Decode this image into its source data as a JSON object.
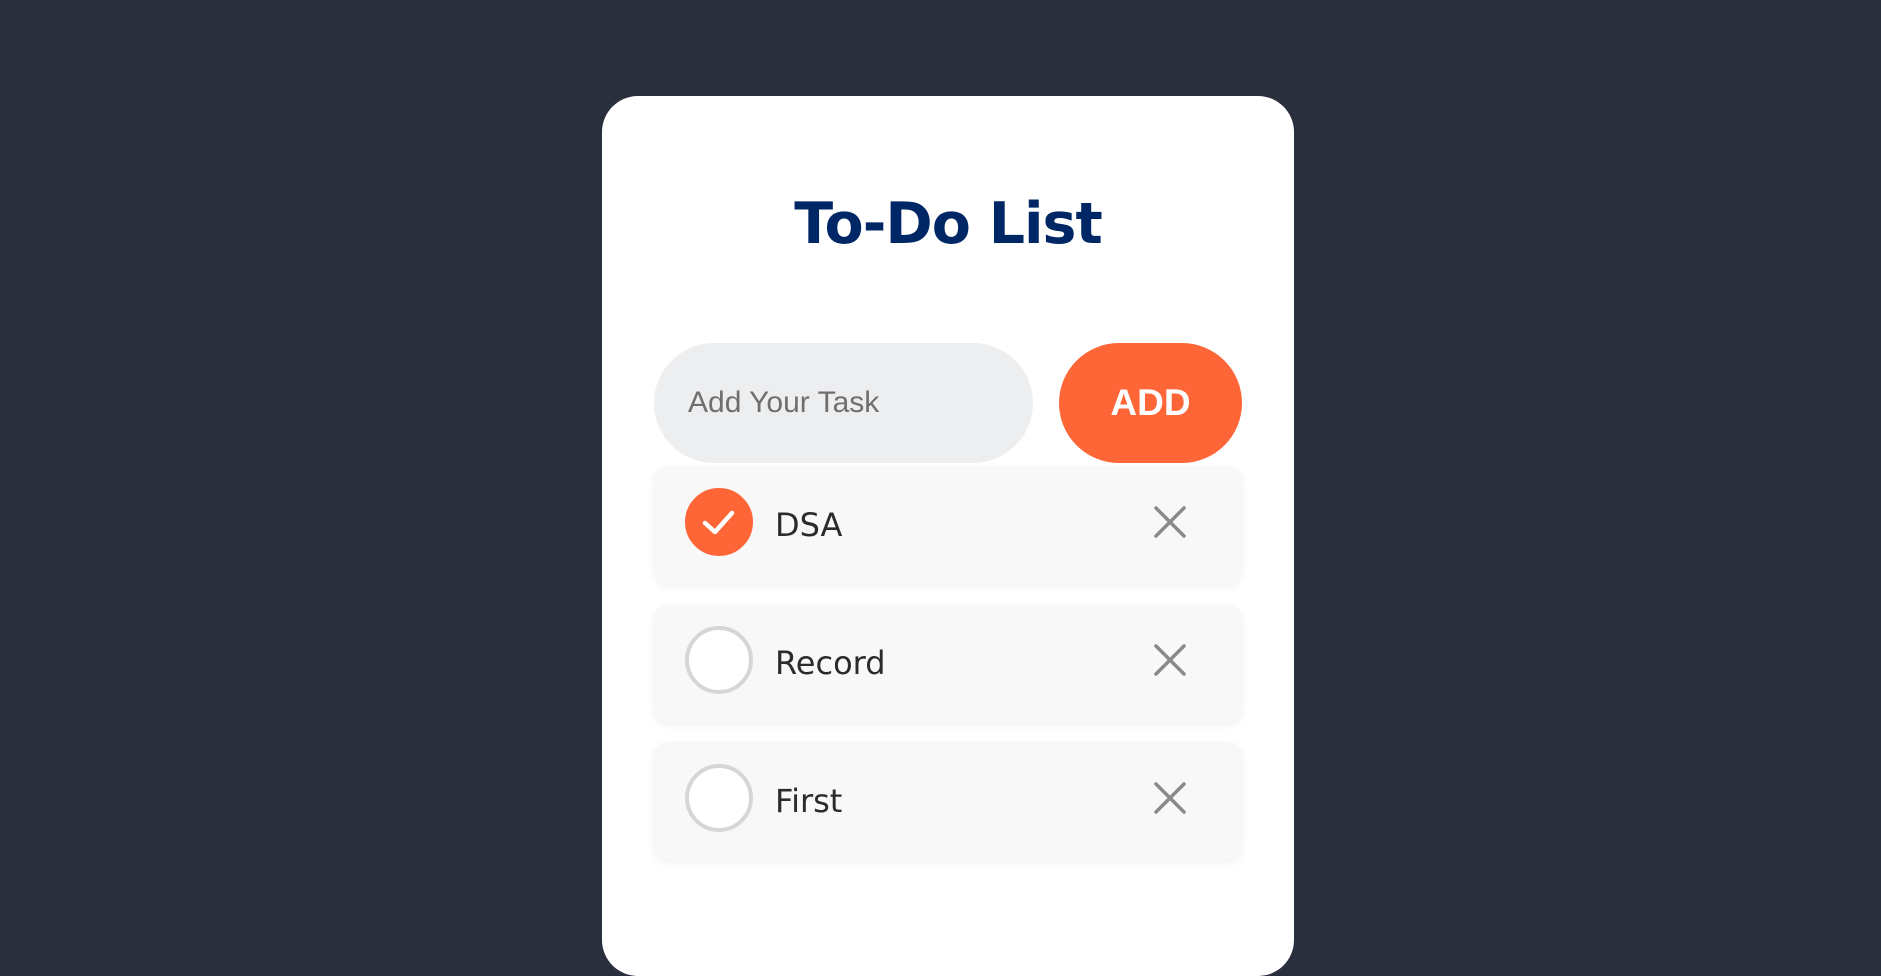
{
  "app": {
    "title": "To-Do List"
  },
  "input": {
    "placeholder": "Add Your Task",
    "value": ""
  },
  "add_button": {
    "label": "ADD"
  },
  "tasks": [
    {
      "label": "DSA",
      "checked": true
    },
    {
      "label": "Record",
      "checked": false
    },
    {
      "label": "First",
      "checked": false
    }
  ],
  "icons": {
    "check": "check-icon",
    "remove": "close-icon"
  },
  "colors": {
    "background": "#2a2f3d",
    "card": "#ffffff",
    "title": "#002765",
    "accent": "#ff6637",
    "input_bg": "#edeef0",
    "item_bg": "#f8f8f8",
    "remove_icon": "#8a8a8a"
  }
}
